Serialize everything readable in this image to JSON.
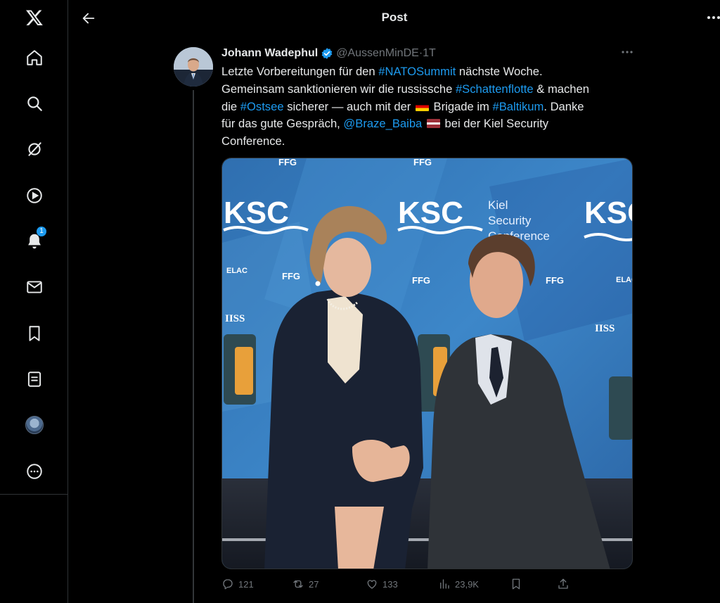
{
  "header": {
    "title": "Post"
  },
  "sidebar": {
    "notifications_badge": "1"
  },
  "tweet": {
    "author_name": "Johann Wadephul",
    "handle": "@AussenMinDE",
    "separator": "·",
    "time": "1T",
    "text": {
      "l1_a": "Letzte Vorbereitungen für den ",
      "l1_tag": "#NATOSummit",
      "l1_b": " nächste Woche.",
      "l2_a": "Gemeinsam sanktionieren wir die russissche ",
      "l2_tag": "#Schattenflotte",
      "l2_b": " & machen",
      "l3_a": "die ",
      "l3_tag": "#Ostsee",
      "l3_b": " sicherer — auch mit der ",
      "l3_c": " Brigade im ",
      "l3_tag2": "#Baltikum",
      "l3_d": ". Danke",
      "l4_a": "für das gute Gespräch, ",
      "l4_mention": "@Braze_Baiba",
      "l4_b": " bei der Kiel Security",
      "l5": "Conference."
    },
    "photo": {
      "backdrop_logo": "KSC",
      "backdrop_name_1": "Kiel",
      "backdrop_name_2": "Security",
      "backdrop_name_3": "Conference",
      "sponsor_1": "FFG",
      "sponsor_2": "IISS",
      "sponsor_3": "ELAC"
    },
    "stats": {
      "replies": "121",
      "reposts": "27",
      "likes": "133",
      "views": "23,9K"
    }
  },
  "colors": {
    "accent": "#1d9bf0",
    "background": "#000000",
    "text": "#e7e9ea",
    "muted": "#71767b",
    "border": "#2f3336"
  }
}
